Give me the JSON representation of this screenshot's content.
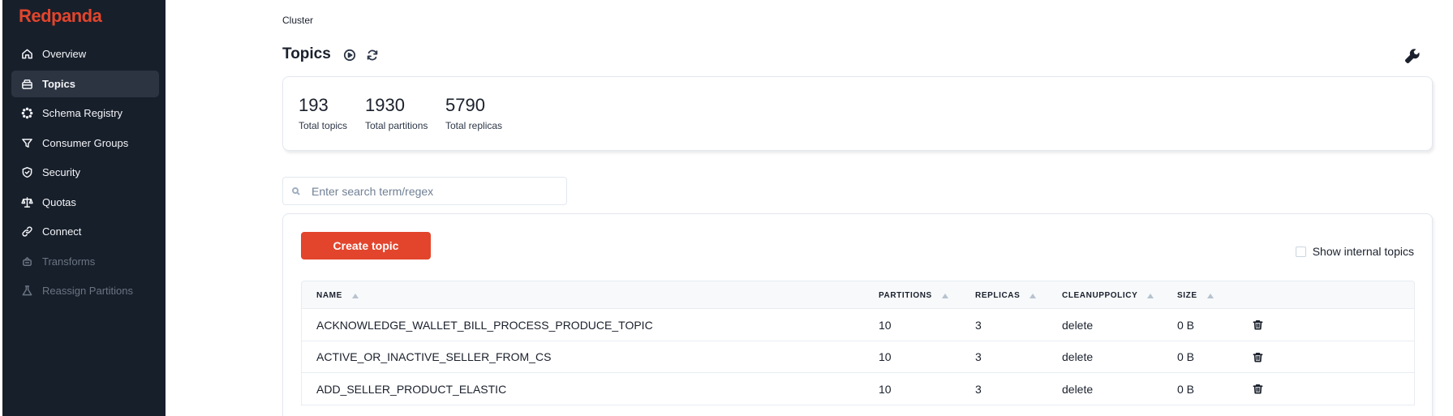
{
  "brand": "Redpanda",
  "sidebar": {
    "items": [
      {
        "label": "Overview",
        "icon": "home-icon"
      },
      {
        "label": "Topics",
        "icon": "topics-icon",
        "active": true
      },
      {
        "label": "Schema Registry",
        "icon": "schema-icon"
      },
      {
        "label": "Consumer Groups",
        "icon": "funnel-icon"
      },
      {
        "label": "Security",
        "icon": "shield-icon"
      },
      {
        "label": "Quotas",
        "icon": "scale-icon"
      },
      {
        "label": "Connect",
        "icon": "link-icon"
      },
      {
        "label": "Transforms",
        "icon": "transforms-icon",
        "disabled": true
      },
      {
        "label": "Reassign Partitions",
        "icon": "flask-icon",
        "disabled": true
      }
    ]
  },
  "header": {
    "breadcrumb": "Cluster",
    "title": "Topics"
  },
  "stats": [
    {
      "value": "193",
      "label": "Total topics"
    },
    {
      "value": "1930",
      "label": "Total partitions"
    },
    {
      "value": "5790",
      "label": "Total replicas"
    }
  ],
  "search": {
    "placeholder": "Enter search term/regex",
    "value": ""
  },
  "actions": {
    "create_label": "Create topic",
    "show_internal_label": "Show internal topics",
    "show_internal_checked": false
  },
  "table": {
    "columns": [
      "NAME",
      "PARTITIONS",
      "REPLICAS",
      "CLEANUPPOLICY",
      "SIZE"
    ],
    "rows": [
      {
        "name": "ACKNOWLEDGE_WALLET_BILL_PROCESS_PRODUCE_TOPIC",
        "partitions": "10",
        "replicas": "3",
        "cleanup": "delete",
        "size": "0 B"
      },
      {
        "name": "ACTIVE_OR_INACTIVE_SELLER_FROM_CS",
        "partitions": "10",
        "replicas": "3",
        "cleanup": "delete",
        "size": "0 B"
      },
      {
        "name": "ADD_SELLER_PRODUCT_ELASTIC",
        "partitions": "10",
        "replicas": "3",
        "cleanup": "delete",
        "size": "0 B"
      }
    ]
  },
  "colors": {
    "accent": "#e2452c",
    "sidebar_bg": "#171f2b"
  }
}
